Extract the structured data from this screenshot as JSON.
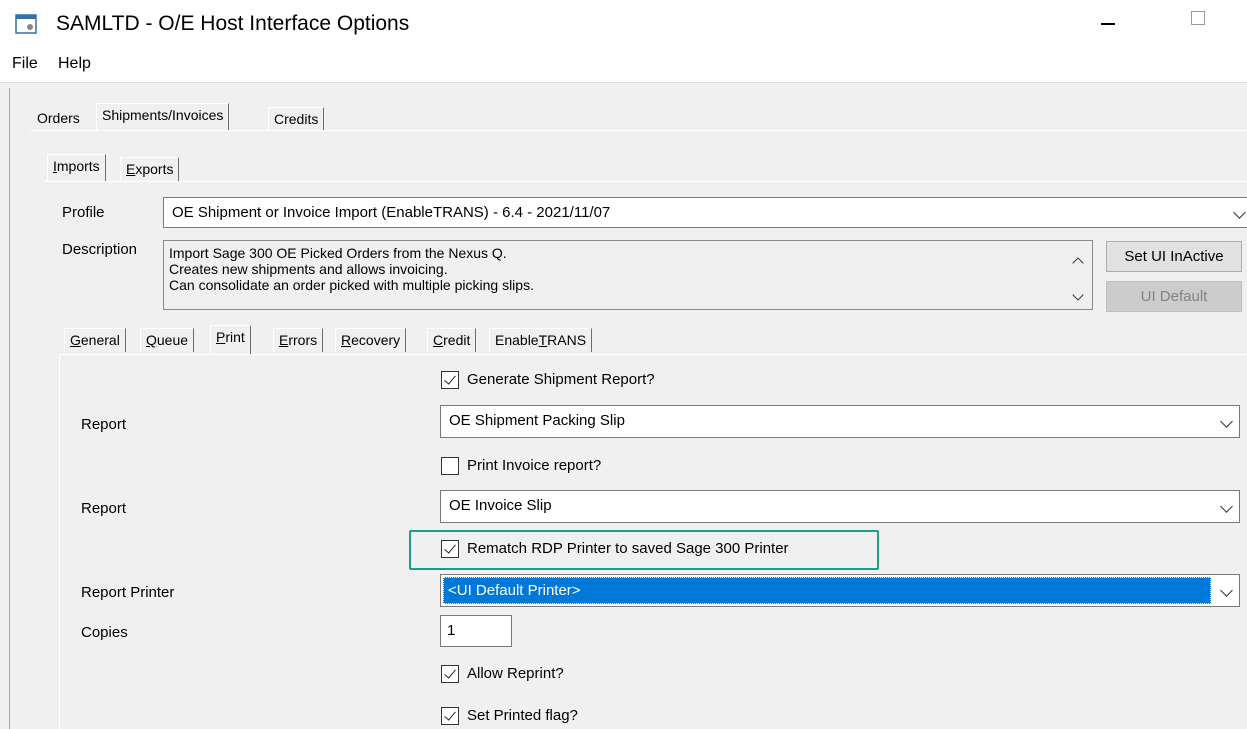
{
  "window": {
    "title": "SAMLTD - O/E Host Interface Options"
  },
  "menu": {
    "file": "File",
    "help": "Help"
  },
  "tabs_top": [
    {
      "label": "Orders"
    },
    {
      "label": "Shipments/Invoices",
      "active": true
    },
    {
      "label": "Credits"
    }
  ],
  "tabs_sub": [
    {
      "label": "Imports",
      "active": true
    },
    {
      "label": "Exports"
    }
  ],
  "profile": {
    "label": "Profile",
    "value": "OE Shipment or Invoice Import (EnableTRANS) - 6.4 - 2021/11/07"
  },
  "description": {
    "label": "Description",
    "lines": [
      "Import Sage 300 OE Picked Orders from the Nexus Q.",
      "Creates new shipments and allows invoicing.",
      "Can consolidate an order picked with multiple picking slips."
    ]
  },
  "buttons": {
    "set_ui_inactive": "Set UI InActive",
    "ui_default": "UI Default"
  },
  "tabs_inner": [
    {
      "label": "General"
    },
    {
      "label": "Queue"
    },
    {
      "label": "Print",
      "active": true
    },
    {
      "label": "Errors"
    },
    {
      "label": "Recovery"
    },
    {
      "label": "Credit"
    },
    {
      "label": "EnableTRANS"
    }
  ],
  "print": {
    "generate_shipment_report": {
      "label": "Generate Shipment Report?",
      "checked": true
    },
    "report1": {
      "label": "Report",
      "value": "OE Shipment Packing Slip"
    },
    "print_invoice_report": {
      "label": "Print Invoice report?",
      "checked": false
    },
    "report2": {
      "label": "Report",
      "value": "OE Invoice Slip"
    },
    "rematch_rdp_printer": {
      "label": "Rematch RDP Printer to saved Sage 300 Printer",
      "checked": true
    },
    "report_printer": {
      "label": "Report Printer",
      "value": "<UI Default Printer>"
    },
    "copies": {
      "label": "Copies",
      "value": "1"
    },
    "allow_reprint": {
      "label": "Allow Reprint?",
      "checked": true
    },
    "set_printed_flag": {
      "label": "Set Printed flag?",
      "checked": true
    }
  },
  "colors": {
    "highlight_box": "#16a085",
    "selection": "#0078d7"
  }
}
